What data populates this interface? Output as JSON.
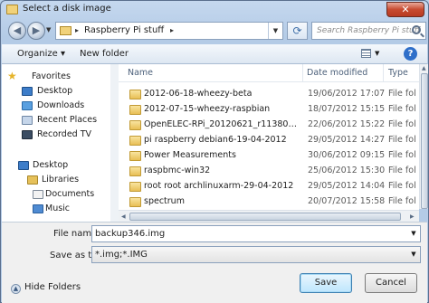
{
  "window": {
    "title": "Select a disk image",
    "close_glyph": "✕"
  },
  "nav": {
    "back_glyph": "◀",
    "forward_glyph": "▶",
    "address_path": "Raspberry Pi stuff",
    "refresh_glyph": "⟳",
    "search_placeholder": "Search Raspberry Pi stuff"
  },
  "toolbar": {
    "organize_label": "Organize ▾",
    "new_folder_label": "New folder",
    "help_glyph": "?"
  },
  "sidebar": {
    "items": [
      {
        "label": "Favorites",
        "icon": "star-icon"
      },
      {
        "label": "Desktop",
        "icon": "desktop-icon"
      },
      {
        "label": "Downloads",
        "icon": "downloads-icon"
      },
      {
        "label": "Recent Places",
        "icon": "recent-places-icon"
      },
      {
        "label": "Recorded TV",
        "icon": "recorded-tv-icon"
      },
      {
        "label": "Desktop",
        "icon": "desktop-icon"
      },
      {
        "label": "Libraries",
        "icon": "libraries-icon"
      },
      {
        "label": "Documents",
        "icon": "documents-icon"
      },
      {
        "label": "Music",
        "icon": "music-icon"
      }
    ]
  },
  "files": {
    "columns": {
      "name": "Name",
      "date": "Date modified",
      "type": "Type"
    },
    "rows": [
      {
        "name": "2012-06-18-wheezy-beta",
        "date": "19/06/2012 17:07",
        "type": "File fol"
      },
      {
        "name": "2012-07-15-wheezy-raspbian",
        "date": "18/07/2012 15:15",
        "type": "File fol"
      },
      {
        "name": "OpenELEC-RPi_20120621_r11380_2GB_S...",
        "date": "22/06/2012 15:22",
        "type": "File fol"
      },
      {
        "name": "pi raspberry debian6-19-04-2012",
        "date": "29/05/2012 14:27",
        "type": "File fol"
      },
      {
        "name": "Power Measurements",
        "date": "30/06/2012 09:15",
        "type": "File fol"
      },
      {
        "name": "raspbmc-win32",
        "date": "25/06/2012 15:30",
        "type": "File fol"
      },
      {
        "name": "root root archlinuxarm-29-04-2012",
        "date": "29/05/2012 14:04",
        "type": "File fol"
      },
      {
        "name": "spectrum",
        "date": "20/07/2012 15:58",
        "type": "File fol"
      }
    ]
  },
  "bottom": {
    "file_name_label": "File name:",
    "file_name_value": "backup346.img",
    "save_type_label": "Save as type:",
    "save_type_value": "*.img;*.IMG",
    "hide_folders_label": "Hide Folders",
    "save_label": "Save",
    "cancel_label": "Cancel"
  }
}
